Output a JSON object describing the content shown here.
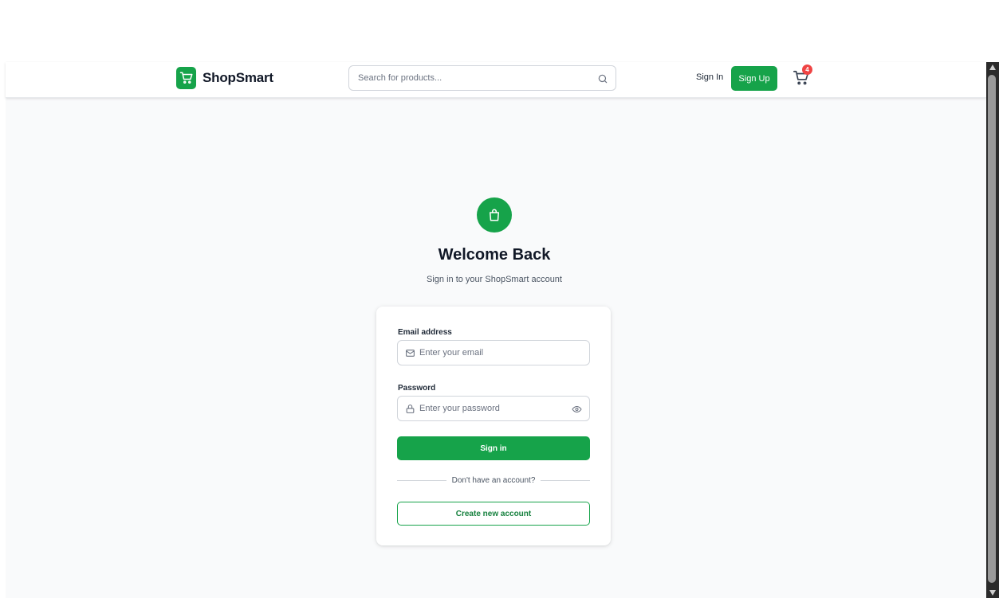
{
  "brand": {
    "name": "ShopSmart",
    "logo_icon": "cart-icon",
    "accent": "#16a34a"
  },
  "search": {
    "placeholder": "Search for products...",
    "value": "",
    "icon": "search-icon"
  },
  "header": {
    "sign_in_label": "Sign In",
    "sign_up_label": "Sign Up",
    "cart_icon": "cart-icon",
    "cart_count": "4",
    "badge_color": "#ef4444"
  },
  "login": {
    "hero_icon": "shopping-bag-icon",
    "title": "Welcome Back",
    "subtitle": "Sign in to your ShopSmart account",
    "email": {
      "label": "Email address",
      "placeholder": "Enter your email",
      "value": "",
      "icon": "mail-icon"
    },
    "password": {
      "label": "Password",
      "placeholder": "Enter your password",
      "value": "",
      "icon": "lock-icon",
      "toggle_icon": "eye-icon"
    },
    "submit_label": "Sign in",
    "divider_text": "Don't have an account?",
    "create_account_label": "Create new account"
  }
}
